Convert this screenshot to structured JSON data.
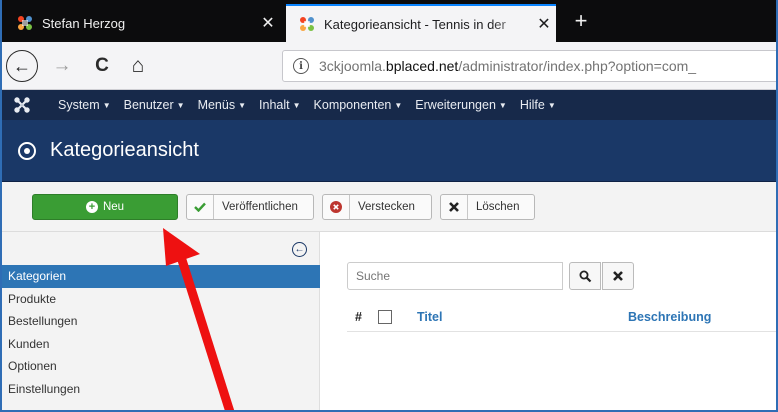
{
  "browser": {
    "tabs": [
      {
        "title": "Stefan Herzog",
        "close": "✕",
        "active": false
      },
      {
        "title": "Kategorieansicht - Tennis in der",
        "close": "✕",
        "active": true
      }
    ],
    "new_tab": "+",
    "url": {
      "prefix": "3ckjoomla.",
      "host": "bplaced.net",
      "path": "/administrator/index.php?option=com_"
    },
    "buttons": {
      "back": "←",
      "forward": "→",
      "reload": "C",
      "home": "⌂",
      "info": "i"
    }
  },
  "admin_menu": {
    "items": [
      {
        "label": "System"
      },
      {
        "label": "Benutzer"
      },
      {
        "label": "Menüs"
      },
      {
        "label": "Inhalt"
      },
      {
        "label": "Komponenten"
      },
      {
        "label": "Erweiterungen"
      },
      {
        "label": "Hilfe"
      }
    ],
    "caret": "▼"
  },
  "page": {
    "title": "Kategorieansicht"
  },
  "toolbar": {
    "new_label": "Neu",
    "publish_label": "Veröffentlichen",
    "hide_label": "Verstecken",
    "delete_label": "Löschen"
  },
  "sidebar": {
    "items": [
      {
        "label": "Kategorien",
        "active": true
      },
      {
        "label": "Produkte"
      },
      {
        "label": "Bestellungen"
      },
      {
        "label": "Kunden"
      },
      {
        "label": "Optionen"
      },
      {
        "label": "Einstellungen"
      }
    ]
  },
  "list": {
    "search_placeholder": "Suche",
    "search_icon_glyph": "⚲",
    "clear_icon_glyph": "✖",
    "columns": {
      "hash": "#",
      "title": "Titel",
      "description": "Beschreibung"
    }
  },
  "colors": {
    "admin_bar": "#17294a",
    "header": "#1a3867",
    "new_button": "#3a9d34",
    "sidebar_active": "#2d75b5",
    "annotation_arrow": "#ee1111"
  },
  "icons": {
    "joomla_logo": "joomla-icon",
    "header_icon": "record-icon",
    "publish_icon": "check-icon",
    "hide_icon": "circle-x-icon",
    "delete_icon": "x-icon",
    "collapse_icon": "arrow-left-circle-icon"
  }
}
